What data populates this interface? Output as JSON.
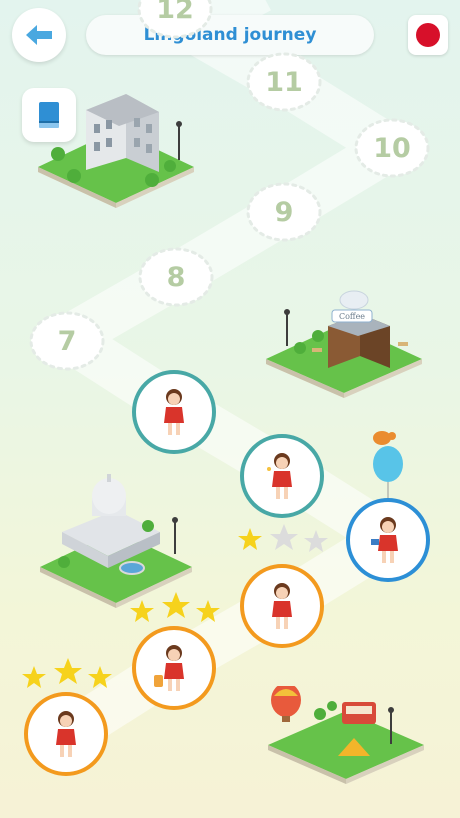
{
  "header": {
    "title": "Lingoland journey",
    "colors": {
      "title": "#2f8fd4",
      "back_arrow": "#4aa8e0",
      "flag": "#d7102a"
    }
  },
  "locked_lessons": [
    "12",
    "11",
    "10",
    "9",
    "8",
    "7"
  ],
  "lessons": [
    {
      "state": "completed",
      "stars": 3,
      "ring": "orange"
    },
    {
      "state": "completed",
      "stars": 3,
      "ring": "orange"
    },
    {
      "state": "completed",
      "stars": 1,
      "ring": "orange"
    },
    {
      "state": "current",
      "stars": 0,
      "ring": "blue"
    },
    {
      "state": "unlocked",
      "stars": 0,
      "ring": "teal"
    },
    {
      "state": "unlocked",
      "stars": 0,
      "ring": "teal"
    }
  ],
  "islands": [
    {
      "name": "city-building"
    },
    {
      "name": "coffee-shop",
      "sign": "Coffee"
    },
    {
      "name": "capitol"
    },
    {
      "name": "campground"
    }
  ]
}
